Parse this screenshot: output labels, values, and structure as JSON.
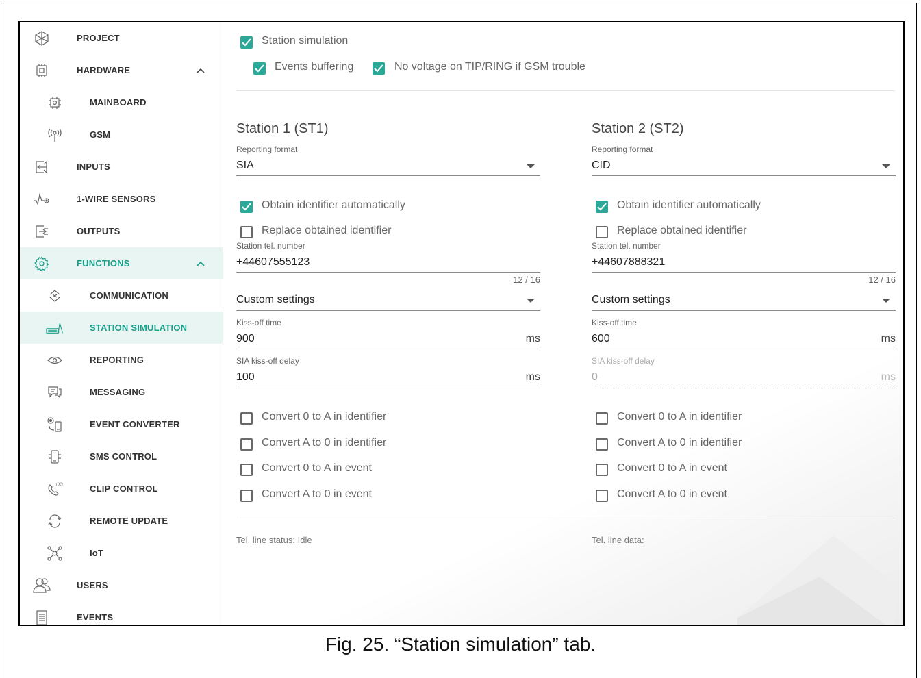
{
  "sidebar": {
    "items": [
      {
        "label": "PROJECT",
        "icon": "project-icon"
      },
      {
        "label": "HARDWARE",
        "icon": "hardware-icon"
      },
      {
        "label": "MAINBOARD",
        "icon": "mainboard-icon"
      },
      {
        "label": "GSM",
        "icon": "gsm-antenna-icon"
      },
      {
        "label": "INPUTS",
        "icon": "inputs-icon"
      },
      {
        "label": "1-WIRE SENSORS",
        "icon": "sensor-icon"
      },
      {
        "label": "OUTPUTS",
        "icon": "outputs-icon"
      },
      {
        "label": "FUNCTIONS",
        "icon": "gear-icon"
      },
      {
        "label": "COMMUNICATION",
        "icon": "communication-icon"
      },
      {
        "label": "STATION SIMULATION",
        "icon": "station-simulation-icon"
      },
      {
        "label": "REPORTING",
        "icon": "eye-icon"
      },
      {
        "label": "MESSAGING",
        "icon": "messaging-icon"
      },
      {
        "label": "EVENT CONVERTER",
        "icon": "event-converter-icon"
      },
      {
        "label": "SMS CONTROL",
        "icon": "sms-control-icon"
      },
      {
        "label": "CLIP CONTROL",
        "icon": "clip-control-icon"
      },
      {
        "label": "REMOTE UPDATE",
        "icon": "remote-update-icon"
      },
      {
        "label": "IoT",
        "icon": "iot-icon"
      },
      {
        "label": "USERS",
        "icon": "users-icon"
      },
      {
        "label": "EVENTS",
        "icon": "events-icon"
      }
    ]
  },
  "top": {
    "station_simulation": {
      "label": "Station simulation",
      "checked": true
    },
    "events_buffering": {
      "label": "Events buffering",
      "checked": true
    },
    "no_voltage": {
      "label": "No voltage on TIP/RING if GSM trouble",
      "checked": true
    }
  },
  "station1": {
    "title": "Station 1 (ST1)",
    "reporting_format_label": "Reporting format",
    "reporting_format": "SIA",
    "obtain_id": {
      "label": "Obtain identifier automatically",
      "checked": true
    },
    "replace_id": {
      "label": "Replace obtained identifier",
      "checked": false
    },
    "tel_label": "Station tel. number",
    "tel_value": "+44607555123",
    "tel_counter": "12 / 16",
    "settings_mode": "Custom settings",
    "kissoff_label": "Kiss-off time",
    "kissoff_value": "900",
    "kissoff_unit": "ms",
    "sia_delay_label": "SIA kiss-off delay",
    "sia_delay_value": "100",
    "sia_delay_unit": "ms",
    "convert": [
      {
        "label": "Convert 0 to A in identifier",
        "checked": false
      },
      {
        "label": "Convert A to 0 in identifier",
        "checked": false
      },
      {
        "label": "Convert 0 to A in event",
        "checked": false
      },
      {
        "label": "Convert A to 0 in event",
        "checked": false
      }
    ],
    "status": "Tel. line status: Idle"
  },
  "station2": {
    "title": "Station 2 (ST2)",
    "reporting_format_label": "Reporting format",
    "reporting_format": "CID",
    "obtain_id": {
      "label": "Obtain identifier automatically",
      "checked": true
    },
    "replace_id": {
      "label": "Replace obtained identifier",
      "checked": false
    },
    "tel_label": "Station tel. number",
    "tel_value": "+44607888321",
    "tel_counter": "12 / 16",
    "settings_mode": "Custom settings",
    "kissoff_label": "Kiss-off time",
    "kissoff_value": "600",
    "kissoff_unit": "ms",
    "sia_delay_label": "SIA kiss-off delay",
    "sia_delay_value": "0",
    "sia_delay_unit": "ms",
    "convert": [
      {
        "label": "Convert 0 to A in identifier",
        "checked": false
      },
      {
        "label": "Convert A to 0 in identifier",
        "checked": false
      },
      {
        "label": "Convert 0 to A in event",
        "checked": false
      },
      {
        "label": "Convert A to 0 in event",
        "checked": false
      }
    ],
    "status": "Tel. line data:"
  },
  "colors": {
    "accent": "#2aa898",
    "active_bg": "#e9f5f3"
  },
  "caption": "Fig. 25. “Station simulation” tab."
}
